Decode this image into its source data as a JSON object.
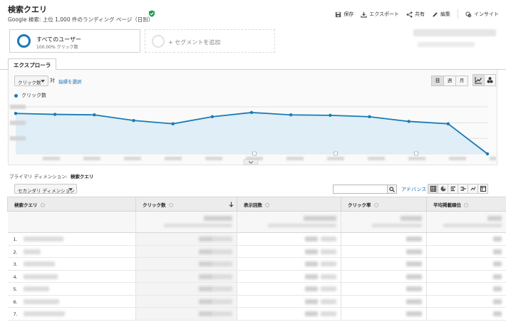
{
  "header": {
    "title": "検索クエリ",
    "subtitle": "Google 検索: 上位 1,000 件のランディング ページ（日別）"
  },
  "toolbar": {
    "save": "保存",
    "export": "エクスポート",
    "share": "共有",
    "edit": "編集",
    "insights": "インサイト"
  },
  "segments": {
    "active_name": "すべてのユーザー",
    "active_sub": "100.00% クリック数",
    "add_label": "+ セグメントを追加"
  },
  "tabs": {
    "explorer": "エクスプローラ"
  },
  "chart_controls": {
    "metric": "クリック数",
    "vs": "対",
    "choose_metric": "指標を選択",
    "granularity": [
      "日",
      "週",
      "月"
    ]
  },
  "chart_data": {
    "type": "area",
    "series": [
      {
        "name": "クリック数",
        "values": [
          0.86,
          0.84,
          0.83,
          0.71,
          0.64,
          0.79,
          0.88,
          0.83,
          0.82,
          0.79,
          0.69,
          0.64,
          0.0
        ]
      }
    ],
    "colors": {
      "line": "#1a7bb3",
      "fill": "#dfeef7"
    },
    "grid": true,
    "legend": "top-left",
    "note": "y values are relative (axis labels obscured)"
  },
  "dimension": {
    "primary_label": "プライマリ ディメンション:",
    "primary_value": "検索クエリ",
    "secondary": "セカンダリ ディメンション"
  },
  "table_controls": {
    "advanced": "アドバンス"
  },
  "table": {
    "columns": [
      "検索クエリ",
      "クリック数",
      "表示回数",
      "クリック率",
      "平均掲載順位"
    ],
    "rows": [
      "1.",
      "2.",
      "3.",
      "4.",
      "5.",
      "6.",
      "7."
    ]
  }
}
